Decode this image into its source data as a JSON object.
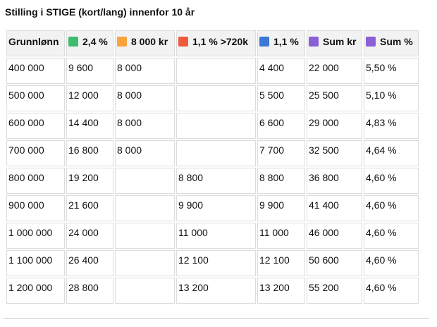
{
  "title": "Stilling i STIGE (kort/lang) innenfor 10 år",
  "colors": {
    "green": "#3dbb6f",
    "orange": "#f9a23c",
    "red": "#f05a3c",
    "blue": "#3b78d8",
    "purple": "#8b5fd6"
  },
  "headers": [
    {
      "label": "Grunnlønn",
      "icon": ""
    },
    {
      "label": "2,4 %",
      "icon": "green-square-icon"
    },
    {
      "label": "8 000 kr",
      "icon": "orange-square-icon"
    },
    {
      "label": "1,1 % >720k",
      "icon": "red-square-icon"
    },
    {
      "label": "1,1 %",
      "icon": "blue-square-icon"
    },
    {
      "label": "Sum kr",
      "icon": "purple-square-icon"
    },
    {
      "label": "Sum %",
      "icon": "purple-square-icon"
    }
  ],
  "rows": [
    [
      "400 000",
      "9 600",
      "8 000",
      "",
      "4 400",
      "22 000",
      "5,50 %"
    ],
    [
      "500 000",
      "12 000",
      "8 000",
      "",
      "5 500",
      "25 500",
      "5,10 %"
    ],
    [
      "600 000",
      "14 400",
      "8 000",
      "",
      "6 600",
      "29 000",
      "4,83 %"
    ],
    [
      "700 000",
      "16 800",
      "8 000",
      "",
      "7 700",
      "32 500",
      "4,64 %"
    ],
    [
      "800 000",
      "19 200",
      "",
      "8 800",
      "8 800",
      "36 800",
      "4,60 %"
    ],
    [
      "900 000",
      "21 600",
      "",
      "9 900",
      "9 900",
      "41 400",
      "4,60 %"
    ],
    [
      "1 000 000",
      "24 000",
      "",
      "11 000",
      "11 000",
      "46 000",
      "4,60 %"
    ],
    [
      "1 100 000",
      "26 400",
      "",
      "12 100",
      "12 100",
      "50 600",
      "4,60 %"
    ],
    [
      "1 200 000",
      "28 800",
      "",
      "13 200",
      "13 200",
      "55 200",
      "4,60 %"
    ]
  ]
}
